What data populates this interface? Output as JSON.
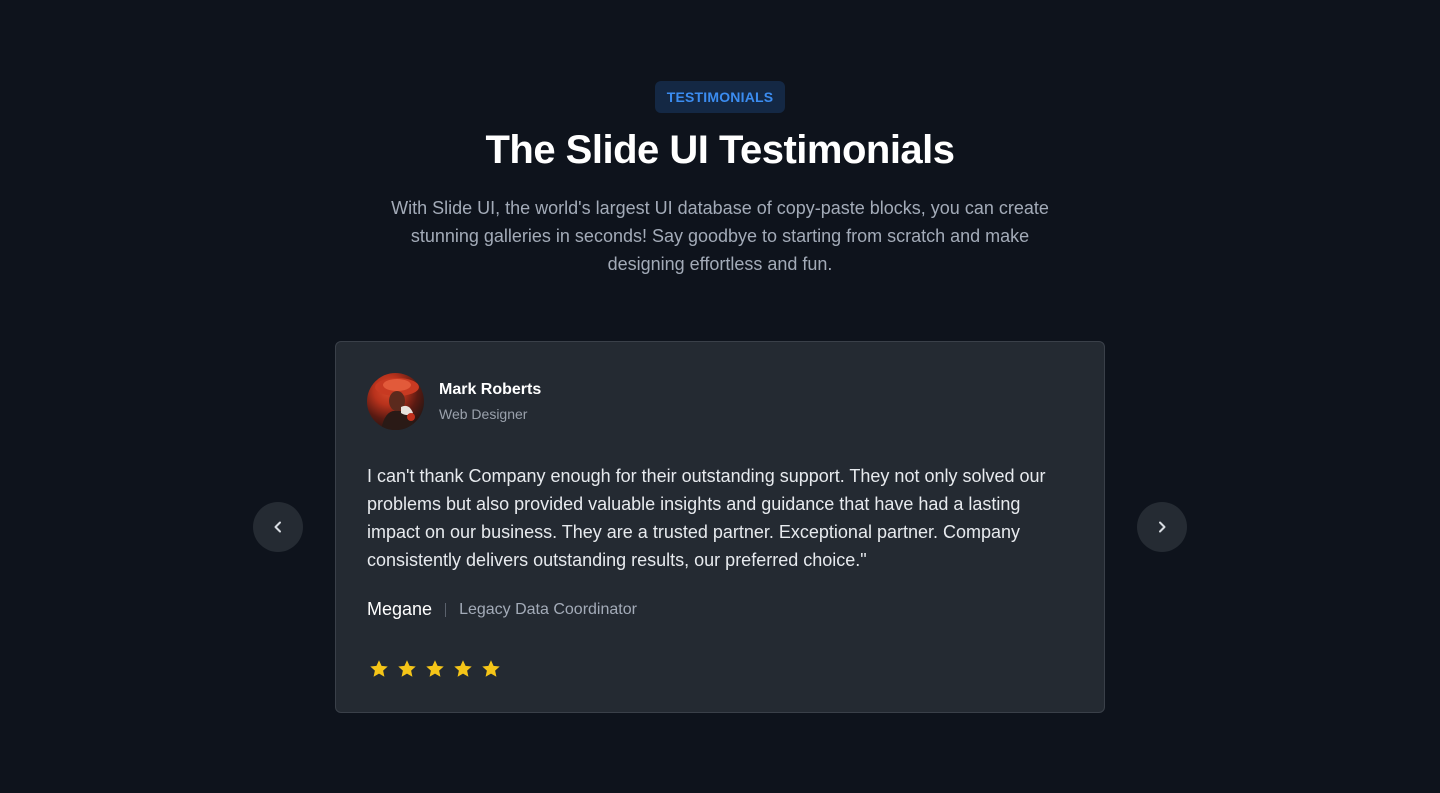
{
  "section": {
    "badge": "TESTIMONIALS",
    "title": "The Slide UI Testimonials",
    "subtitle": "With Slide UI, the world's largest UI database of copy-paste blocks, you can create stunning galleries in seconds! Say goodbye to starting from scratch and make designing effortless and fun."
  },
  "testimonial": {
    "author_name": "Mark Roberts",
    "author_role": "Web Designer",
    "quote": "I can't thank Company enough for their outstanding support. They not only solved our problems but also provided valuable insights and guidance that have had a lasting impact on our business. They are a trusted partner. Exceptional partner. Company consistently delivers outstanding results, our preferred choice.\"",
    "reviewer_name": "Megane",
    "reviewer_role": "Legacy Data Coordinator",
    "rating": 5,
    "rating_max": 5
  },
  "colors": {
    "background": "#0e131c",
    "card": "#242a32",
    "accent": "#3b8cf0",
    "star": "#f5c518"
  },
  "icons": {
    "prev": "chevron-left-icon",
    "next": "chevron-right-icon",
    "rating": "star-icon"
  }
}
